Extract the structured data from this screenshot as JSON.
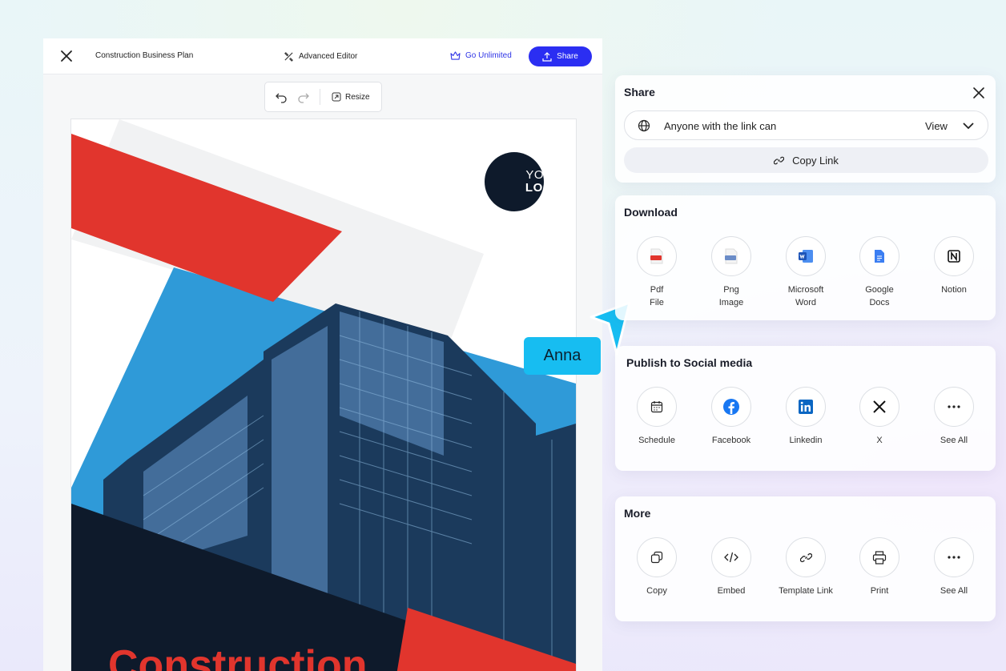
{
  "editor": {
    "doc_title": "Construction Business Plan",
    "advanced_editor": "Advanced Editor",
    "go_unlimited": "Go Unlimited",
    "share_label": "Share",
    "resize_label": "Resize"
  },
  "canvas": {
    "logo_line1": "YOUR",
    "logo_line2": "LOGO",
    "headline": "Construction"
  },
  "collaborator": {
    "name": "Anna"
  },
  "share_panel": {
    "title": "Share",
    "access_text": "Anyone with the link can",
    "permission": "View",
    "copy_link": "Copy Link"
  },
  "download_panel": {
    "title": "Download",
    "items": [
      {
        "line1": "Pdf",
        "line2": "File"
      },
      {
        "line1": "Png",
        "line2": "Image"
      },
      {
        "line1": "Microsoft",
        "line2": "Word"
      },
      {
        "line1": "Google",
        "line2": "Docs"
      },
      {
        "line1": "Notion",
        "line2": ""
      }
    ]
  },
  "social_panel": {
    "title": "Publish to Social media",
    "items": [
      {
        "label": "Schedule"
      },
      {
        "label": "Facebook"
      },
      {
        "label": "Linkedin"
      },
      {
        "label": "X"
      },
      {
        "label": "See All"
      }
    ]
  },
  "more_panel": {
    "title": "More",
    "items": [
      {
        "label": "Copy"
      },
      {
        "label": "Embed"
      },
      {
        "label": "Template Link"
      },
      {
        "label": "Print"
      },
      {
        "label": "See All"
      }
    ]
  },
  "colors": {
    "accent": "#2b2ef2",
    "brand_red": "#e1352d",
    "navy": "#0e1a2b",
    "cursor": "#17bdf1"
  }
}
